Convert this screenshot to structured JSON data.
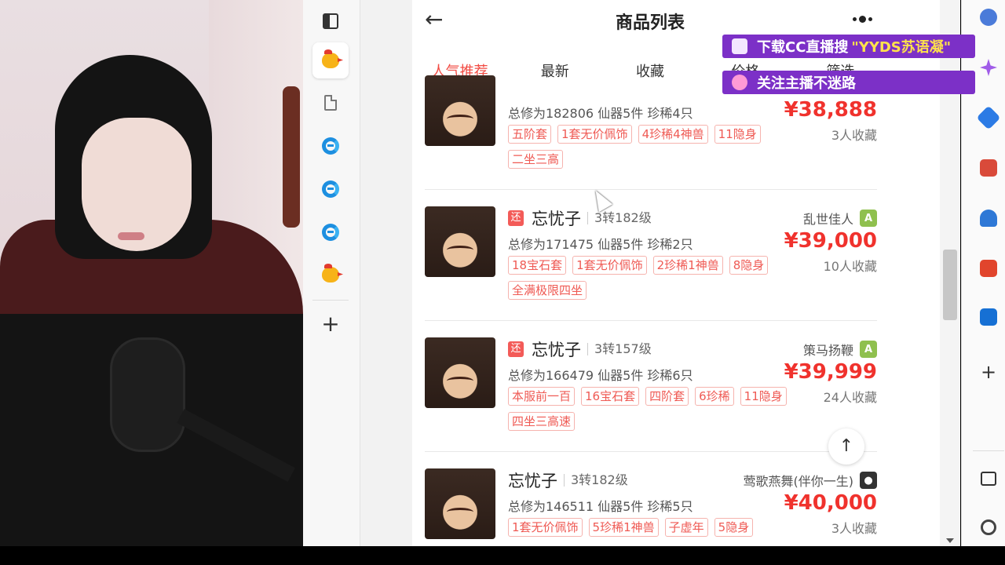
{
  "app": {
    "title": "商品列表",
    "tabs": [
      {
        "label": "人气推荐",
        "active": true
      },
      {
        "label": "最新",
        "active": false
      },
      {
        "label": "收藏",
        "active": false
      },
      {
        "label": "价格",
        "active": false
      },
      {
        "label": "筛选",
        "active": false
      }
    ]
  },
  "items": [
    {
      "stats": "总修为182806  仙器5件  珍稀4只",
      "price": "¥38,888",
      "fav": "3人收藏",
      "tags": [
        "五阶套",
        "1套无价佩饰",
        "4珍稀4神兽",
        "11隐身",
        "二坐三高"
      ]
    },
    {
      "huan": "还",
      "name": "忘忧子",
      "level": "3转182级",
      "seller": "乱世佳人",
      "os": "android",
      "stats": "总修为171475  仙器5件  珍稀2只",
      "price": "¥39,000",
      "fav": "10人收藏",
      "tags": [
        "18宝石套",
        "1套无价佩饰",
        "2珍稀1神兽",
        "8隐身",
        "全满极限四坐"
      ]
    },
    {
      "huan": "还",
      "name": "忘忧子",
      "level": "3转157级",
      "seller": "策马扬鞭",
      "os": "android",
      "stats": "总修为166479  仙器5件  珍稀6只",
      "price": "¥39,999",
      "fav": "24人收藏",
      "tags": [
        "本服前一百",
        "16宝石套",
        "四阶套",
        "6珍稀",
        "11隐身",
        "四坐三高速"
      ]
    },
    {
      "name": "忘忧子",
      "level": "3转182级",
      "seller": "莺歌燕舞(伴你一生)",
      "os": "apple",
      "stats": "总修为146511  仙器5件  珍稀5只",
      "price": "¥40,000",
      "fav": "3人收藏",
      "tags": [
        "1套无价佩饰",
        "5珍稀1神兽",
        "子虚年",
        "5隐身"
      ]
    }
  ],
  "overlay": {
    "download_text": "下载CC直播搜",
    "download_highlight": "\"YYDS苏语凝\"",
    "follow_text": "关注主播不迷路"
  },
  "colors": {
    "accent": "#f24b43",
    "price": "#f0322d",
    "overlay": "#7c30c7"
  }
}
